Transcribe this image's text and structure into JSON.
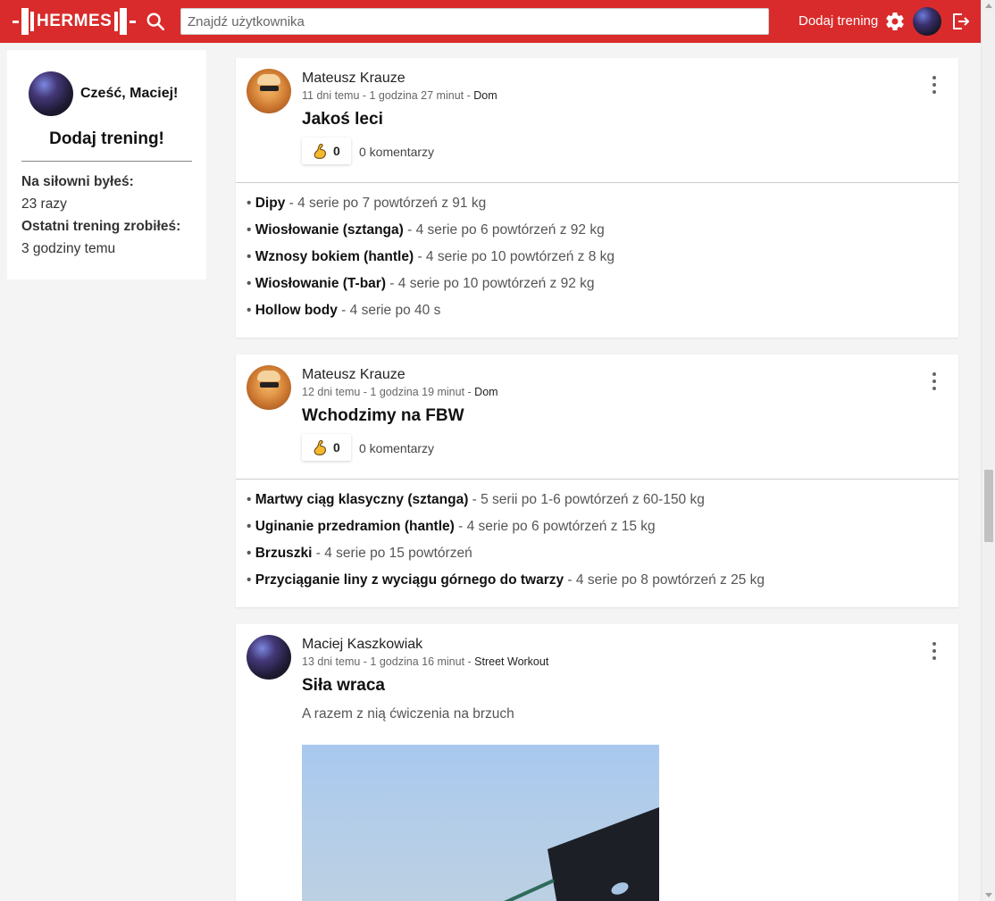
{
  "header": {
    "logo_text": "HERMES",
    "search_placeholder": "Znajdź użytkownika",
    "add_training_label": "Dodaj trening",
    "brand_color": "#d92b2b"
  },
  "sidebar": {
    "greeting": "Cześć, Maciej!",
    "add_training": "Dodaj trening!",
    "visits_label": "Na siłowni byłeś:",
    "visits_value": "23 razy",
    "last_label": "Ostatni trening zrobiłeś:",
    "last_value": "3 godziny temu"
  },
  "posts": [
    {
      "author": "Mateusz Krauze",
      "time": "11 dni temu - 1 godzina 27 minut",
      "sep": " - ",
      "location": "Dom",
      "title": "Jakoś leci",
      "likes": "0",
      "comments": "0 komentarzy",
      "exercises": [
        {
          "name": "Dipy",
          "detail": " - 4 serie po 7 powtórzeń z 91 kg"
        },
        {
          "name": "Wiosłowanie (sztanga)",
          "detail": " - 4 serie po 6 powtórzeń z 92 kg"
        },
        {
          "name": "Wznosy bokiem (hantle)",
          "detail": " - 4 serie po 10 powtórzeń z 8 kg"
        },
        {
          "name": "Wiosłowanie (T-bar)",
          "detail": " - 4 serie po 10 powtórzeń z 92 kg"
        },
        {
          "name": "Hollow body",
          "detail": " - 4 serie po 40 s"
        }
      ]
    },
    {
      "author": "Mateusz Krauze",
      "time": "12 dni temu - 1 godzina 19 minut",
      "sep": " - ",
      "location": "Dom",
      "title": "Wchodzimy na FBW",
      "likes": "0",
      "comments": "0 komentarzy",
      "exercises": [
        {
          "name": "Martwy ciąg klasyczny (sztanga)",
          "detail": " - 5 serii po 1-6 powtórzeń z 60-150 kg"
        },
        {
          "name": "Uginanie przedramion (hantle)",
          "detail": " - 4 serie po 6 powtórzeń z 15 kg"
        },
        {
          "name": "Brzuszki",
          "detail": " - 4 serie po 15 powtórzeń"
        },
        {
          "name": "Przyciąganie liny z wyciągu górnego do twarzy",
          "detail": " - 4 serie po 8 powtórzeń z 25 kg"
        }
      ]
    },
    {
      "author": "Maciej Kaszkowiak",
      "time": "13 dni temu - 1 godzina 16 minut",
      "sep": " - ",
      "location": "Street Workout",
      "title": "Siła wraca",
      "description": "A razem z nią ćwiczenia na brzuch"
    }
  ]
}
